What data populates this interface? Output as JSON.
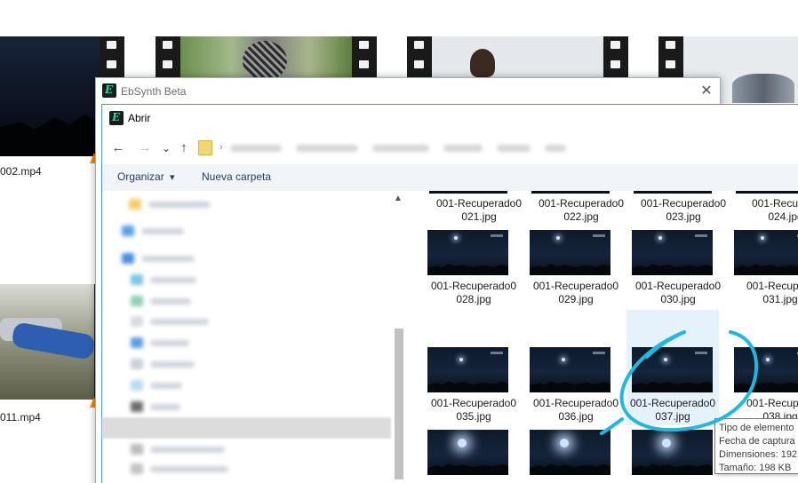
{
  "background_files": {
    "labels": [
      "002.mp4",
      "011.mp4"
    ]
  },
  "ebsynth_window": {
    "title": "EbSynth Beta",
    "logo_letter": "E",
    "close_glyph": "✕"
  },
  "open_dialog": {
    "title": "Abrir",
    "nav": {
      "back_glyph": "←",
      "forward_glyph": "→",
      "recent_glyph": "⌄",
      "up_glyph": "↑",
      "crumb_separator": "›"
    },
    "commands": {
      "organize_label": "Organizar",
      "organize_arrow": "▾",
      "new_folder_label": "Nueva carpeta"
    },
    "nav_pane_scroll_up": "▲",
    "files": {
      "row0": [
        {
          "name_line1": "001-Recuperado0",
          "name_line2": "021.jpg"
        },
        {
          "name_line1": "001-Recuperado0",
          "name_line2": "022.jpg"
        },
        {
          "name_line1": "001-Recuperado0",
          "name_line2": "023.jpg"
        },
        {
          "name_line1": "001-Recupera",
          "name_line2": "024.jpg"
        }
      ],
      "row1": [
        {
          "name_line1": "001-Recuperado0",
          "name_line2": "028.jpg"
        },
        {
          "name_line1": "001-Recuperado0",
          "name_line2": "029.jpg"
        },
        {
          "name_line1": "001-Recuperado0",
          "name_line2": "030.jpg"
        },
        {
          "name_line1": "001-Recupera",
          "name_line2": "031.jpg"
        }
      ],
      "row2": [
        {
          "name_line1": "001-Recuperado0",
          "name_line2": "035.jpg"
        },
        {
          "name_line1": "001-Recuperado0",
          "name_line2": "036.jpg"
        },
        {
          "name_line1": "001-Recuperado0",
          "name_line2": "037.jpg"
        },
        {
          "name_line1": "001-Recupera",
          "name_line2": "038.jpg"
        }
      ]
    },
    "tooltip": {
      "line1": "Tipo de elemento",
      "line2": "Fecha de captura",
      "line3": "Dimensiones: 192",
      "line4": "Tamaño: 198 KB"
    }
  },
  "colors": {
    "annotation_stroke": "#1fb8e0",
    "selection_bg": "#e5f1fb",
    "command_bar_bg": "#f1f5fa",
    "link_text": "#1e3f67"
  }
}
